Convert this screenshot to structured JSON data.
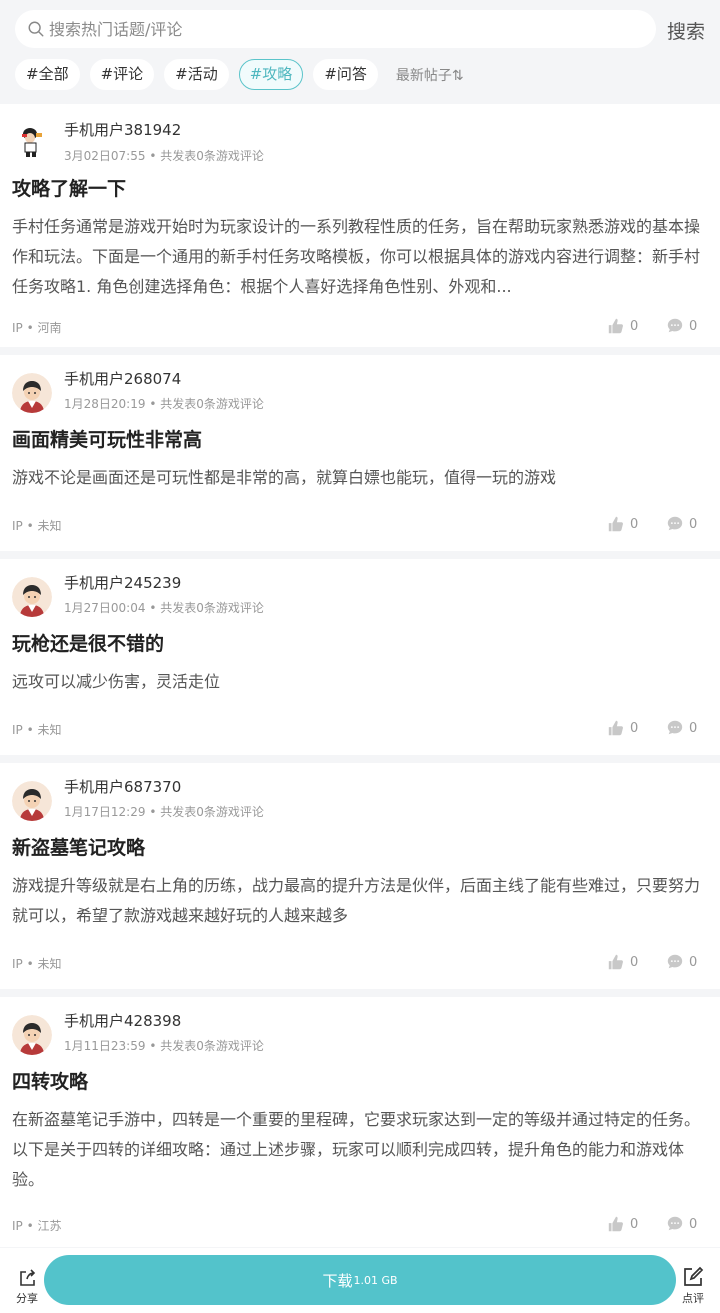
{
  "search": {
    "placeholder": "搜索热门话题/评论",
    "button_label": "搜索"
  },
  "tabs": [
    {
      "label": "#全部",
      "active": false
    },
    {
      "label": "#评论",
      "active": false
    },
    {
      "label": "#活动",
      "active": false
    },
    {
      "label": "#攻略",
      "active": true
    },
    {
      "label": "#问答",
      "active": false
    }
  ],
  "sort_label": "最新帖子⇅",
  "accent_color": "#53c3cb",
  "posts": [
    {
      "username": "手机用户381942",
      "time": "3月02日07:55",
      "meta": " • 共发表0条游戏评论",
      "title": "攻略了解一下",
      "body": "手村任务通常是游戏开始时为玩家设计的一系列教程性质的任务，旨在帮助玩家熟悉游戏的基本操作和玩法。下面是一个通用的新手村任务攻略模板，你可以根据具体的游戏内容进行调整：新手村任务攻略1. 角色创建选择角色：根据个人喜好选择角色性别、外观和...",
      "ip": "IP • 河南",
      "likes": "0",
      "comments": "0",
      "avatar": "custom-avatar"
    },
    {
      "username": "手机用户268074",
      "time": "1月28日20:19",
      "meta": " • 共发表0条游戏评论",
      "title": "画面精美可玩性非常高",
      "body": "游戏不论是画面还是可玩性都是非常的高，就算白嫖也能玩，值得一玩的游戏",
      "ip": "IP • 未知",
      "likes": "0",
      "comments": "0",
      "avatar": "default-avatar"
    },
    {
      "username": "手机用户245239",
      "time": "1月27日00:04",
      "meta": " • 共发表0条游戏评论",
      "title": "玩枪还是很不错的",
      "body": "远攻可以减少伤害，灵活走位",
      "ip": "IP • 未知",
      "likes": "0",
      "comments": "0",
      "avatar": "default-avatar"
    },
    {
      "username": "手机用户687370",
      "time": "1月17日12:29",
      "meta": " • 共发表0条游戏评论",
      "title": "新盗墓笔记攻略",
      "body": "游戏提升等级就是右上角的历练，战力最高的提升方法是伙伴，后面主线了能有些难过，只要努力就可以，希望了款游戏越来越好玩的人越来越多",
      "ip": "IP • 未知",
      "likes": "0",
      "comments": "0",
      "avatar": "default-avatar"
    },
    {
      "username": "手机用户428398",
      "time": "1月11日23:59",
      "meta": " • 共发表0条游戏评论",
      "title": "四转攻略",
      "body": "在新盗墓笔记手游中，四转是一个重要的里程碑，它要求玩家达到一定的等级并通过特定的任务。以下是关于四转的详细攻略：通过上述步骤，玩家可以顺利完成四转，提升角色的能力和游戏体验。",
      "ip": "IP • 江苏",
      "likes": "0",
      "comments": "0",
      "avatar": "default-avatar"
    }
  ],
  "bottom": {
    "share_label": "分享",
    "download_label": "下载",
    "download_size": "1.01 GB",
    "review_label": "点评"
  }
}
